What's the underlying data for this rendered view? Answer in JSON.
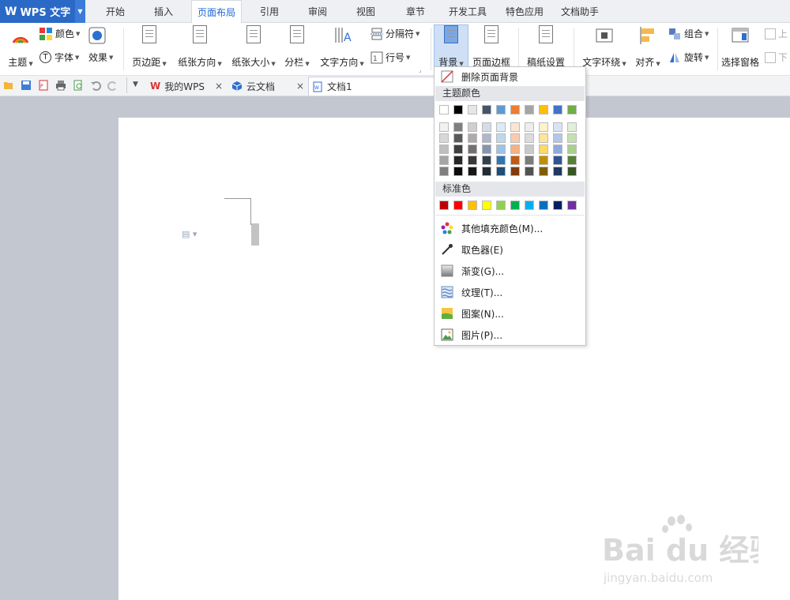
{
  "app": {
    "logo_label": "WPS 文字"
  },
  "menu_tabs": [
    "开始",
    "插入",
    "页面布局",
    "引用",
    "审阅",
    "视图",
    "章节",
    "开发工具",
    "特色应用",
    "文档助手"
  ],
  "ribbon": {
    "theme": "主题",
    "colors": "颜色",
    "fonts": "字体",
    "effects": "效果",
    "margins": "页边距",
    "orientation": "纸张方向",
    "size": "纸张大小",
    "columns": "分栏",
    "text_direction": "文字方向",
    "breaks": "分隔符",
    "line_numbers": "行号",
    "background": "背景",
    "page_border": "页面边框",
    "manuscript": "稿纸设置",
    "wrap_text": "文字环绕",
    "align": "对齐",
    "group": "组合",
    "rotate": "旋转",
    "selection_pane": "选择窗格",
    "bring_forward": "上",
    "send_backward": "下"
  },
  "doc_tabs": [
    "我的WPS",
    "云文档",
    "文档1"
  ],
  "dropdown": {
    "remove_background": "删除页面背景",
    "theme_colors_header": "主题颜色",
    "standard_colors_header": "标准色",
    "items": [
      "其他填充颜色(M)...",
      "取色器(E)",
      "渐变(G)...",
      "纹理(T)...",
      "图案(N)...",
      "图片(P)..."
    ],
    "theme_top_row": [
      "#ffffff",
      "#000000",
      "#e7e6e6",
      "#44546a",
      "#5b9bd5",
      "#ed7d31",
      "#a5a5a5",
      "#ffc000",
      "#4472c4",
      "#70ad47"
    ],
    "theme_shades": [
      [
        "#f2f2f2",
        "#7f7f7f",
        "#d0cece",
        "#d6dce4",
        "#deebf6",
        "#fbe5d5",
        "#ededed",
        "#fff2cc",
        "#dae3f3",
        "#e2efd9"
      ],
      [
        "#d8d8d8",
        "#595959",
        "#aeaaaa",
        "#adb9ca",
        "#bdd7ee",
        "#f8cbad",
        "#dbdbdb",
        "#fee599",
        "#b4c6e7",
        "#c5e0b3"
      ],
      [
        "#bfbfbf",
        "#3f3f3f",
        "#757070",
        "#8496b0",
        "#9dc3e6",
        "#f4b183",
        "#c9c9c9",
        "#ffd965",
        "#8faadc",
        "#a8d08d"
      ],
      [
        "#a5a5a5",
        "#262626",
        "#3a3838",
        "#323f4f",
        "#2e75b5",
        "#c55a11",
        "#7b7b7b",
        "#bf9000",
        "#2f5496",
        "#538135"
      ],
      [
        "#7f7f7f",
        "#0c0c0c",
        "#171616",
        "#222a35",
        "#1e4e79",
        "#833c0b",
        "#525252",
        "#7f6000",
        "#1f3864",
        "#375623"
      ]
    ],
    "standard_colors": [
      "#c00000",
      "#ff0000",
      "#ffc000",
      "#ffff00",
      "#92d050",
      "#00b050",
      "#00b0f0",
      "#0070c0",
      "#002060",
      "#7030a0"
    ]
  },
  "watermark": {
    "brand": "Bai du 经验",
    "url": "jingyan.baidu.com"
  }
}
